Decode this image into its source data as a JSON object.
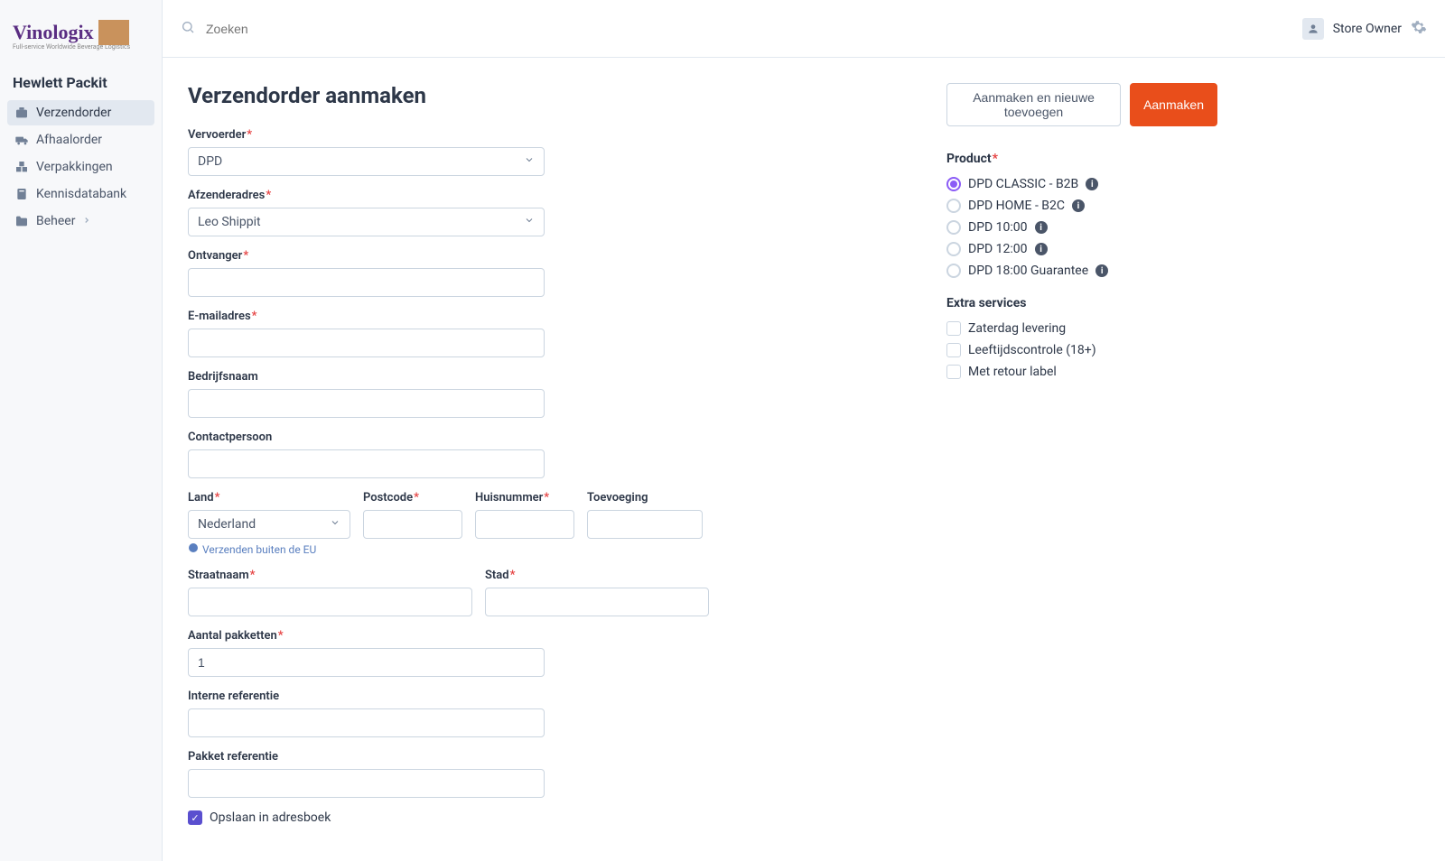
{
  "logo": {
    "title": "Vinologix",
    "subtitle": "Full-service Worldwide Beverage Logistics"
  },
  "company": "Hewlett Packit",
  "nav": [
    {
      "label": "Verzendorder",
      "active": true
    },
    {
      "label": "Afhaalorder"
    },
    {
      "label": "Verpakkingen"
    },
    {
      "label": "Kennisdatabank"
    },
    {
      "label": "Beheer",
      "chevron": true
    }
  ],
  "search": {
    "placeholder": "Zoeken"
  },
  "user": {
    "name": "Store Owner"
  },
  "page": {
    "title": "Verzendorder aanmaken",
    "btn_secondary": "Aanmaken en nieuwe toevoegen",
    "btn_primary": "Aanmaken"
  },
  "form": {
    "vervoerder": {
      "label": "Vervoerder",
      "value": "DPD"
    },
    "afzender": {
      "label": "Afzenderadres",
      "value": "Leo Shippit"
    },
    "ontvanger": {
      "label": "Ontvanger"
    },
    "email": {
      "label": "E-mailadres"
    },
    "bedrijf": {
      "label": "Bedrijfsnaam"
    },
    "contact": {
      "label": "Contactpersoon"
    },
    "land": {
      "label": "Land",
      "value": "Nederland",
      "hint": "Verzenden buiten de EU"
    },
    "postcode": {
      "label": "Postcode"
    },
    "huisnr": {
      "label": "Huisnummer"
    },
    "toevoeging": {
      "label": "Toevoeging"
    },
    "straat": {
      "label": "Straatnaam"
    },
    "stad": {
      "label": "Stad"
    },
    "aantal": {
      "label": "Aantal pakketten",
      "value": "1"
    },
    "interne": {
      "label": "Interne referentie"
    },
    "pakketref": {
      "label": "Pakket referentie"
    },
    "opslaan": {
      "label": "Opslaan in adresboek",
      "checked": true
    }
  },
  "product": {
    "title": "Product",
    "options": [
      {
        "label": "DPD CLASSIC - B2B",
        "selected": true,
        "info": true
      },
      {
        "label": "DPD HOME - B2C",
        "info": true
      },
      {
        "label": "DPD 10:00",
        "info": true
      },
      {
        "label": "DPD 12:00",
        "info": true
      },
      {
        "label": "DPD 18:00 Guarantee",
        "info": true
      }
    ]
  },
  "extras": {
    "title": "Extra services",
    "options": [
      {
        "label": "Zaterdag levering"
      },
      {
        "label": "Leeftijdscontrole (18+)"
      },
      {
        "label": "Met retour label"
      }
    ]
  }
}
